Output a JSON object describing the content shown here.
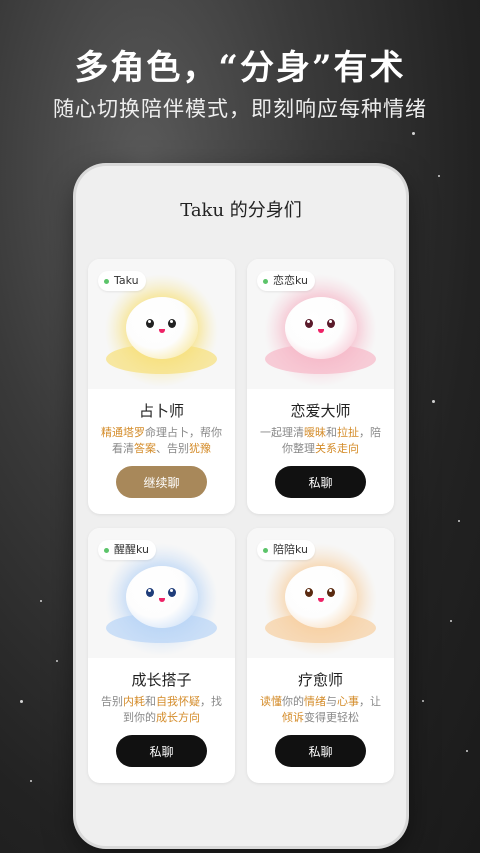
{
  "header": {
    "title": "多角色，“分身”有术",
    "subtitle": "随心切换陪伴模式，即刻响应每种情绪"
  },
  "phone": {
    "title": "Taku 的分身们"
  },
  "cards": [
    {
      "tag": "Taku",
      "name": "占卜师",
      "desc_parts": [
        {
          "t": "精通塔罗",
          "hl": true
        },
        {
          "t": "命理占卜，帮你看清",
          "hl": false
        },
        {
          "t": "答案",
          "hl": true
        },
        {
          "t": "、告别",
          "hl": false
        },
        {
          "t": "犹豫",
          "hl": true
        }
      ],
      "button": "继续聊",
      "button_style": "gold",
      "glow": "#f7e07a",
      "eye_color": "#222"
    },
    {
      "tag": "恋恋ku",
      "name": "恋爱大师",
      "desc_parts": [
        {
          "t": "一起理清",
          "hl": false
        },
        {
          "t": "暧昧",
          "hl": true
        },
        {
          "t": "和",
          "hl": false
        },
        {
          "t": "拉扯",
          "hl": true
        },
        {
          "t": "，陪你整理",
          "hl": false
        },
        {
          "t": "关系走向",
          "hl": true
        }
      ],
      "button": "私聊",
      "button_style": "dark",
      "glow": "#f6b8c8",
      "eye_color": "#5a1a2a"
    },
    {
      "tag": "醒醒ku",
      "name": "成长搭子",
      "desc_parts": [
        {
          "t": "告别",
          "hl": false
        },
        {
          "t": "内耗",
          "hl": true
        },
        {
          "t": "和",
          "hl": false
        },
        {
          "t": "自我怀疑",
          "hl": true
        },
        {
          "t": "，找到你的",
          "hl": false
        },
        {
          "t": "成长方向",
          "hl": true
        }
      ],
      "button": "私聊",
      "button_style": "dark",
      "glow": "#b8d4f6",
      "eye_color": "#1f3d7a"
    },
    {
      "tag": "陪陪ku",
      "name": "疗愈师",
      "desc_parts": [
        {
          "t": "读懂",
          "hl": true
        },
        {
          "t": "你的",
          "hl": false
        },
        {
          "t": "情绪",
          "hl": true
        },
        {
          "t": "与",
          "hl": false
        },
        {
          "t": "心事",
          "hl": true
        },
        {
          "t": "，让",
          "hl": false
        },
        {
          "t": "倾诉",
          "hl": true
        },
        {
          "t": "变得更轻松",
          "hl": false
        }
      ],
      "button": "私聊",
      "button_style": "dark",
      "glow": "#f7cfa0",
      "eye_color": "#5a2a10"
    }
  ]
}
